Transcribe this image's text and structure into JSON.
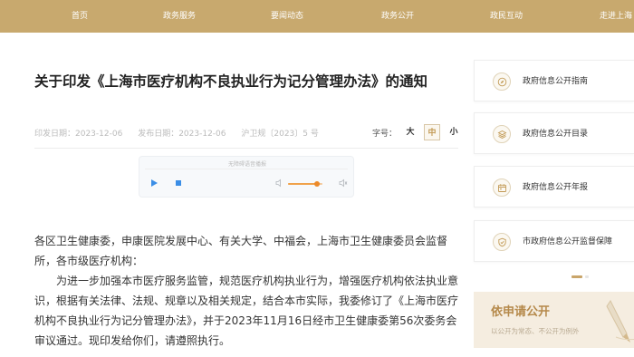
{
  "nav": {
    "items": [
      "首页",
      "政务服务",
      "要闻动态",
      "政务公开",
      "政民互动",
      "走进上海"
    ]
  },
  "article": {
    "title": "关于印发《上海市医疗机构不良执业行为记分管理办法》的通知",
    "print_date": "印发日期：2023-12-06",
    "publish_date": "发布日期：2023-12-06",
    "doc_no": "沪卫规〔2023〕5 号",
    "font_label": "字号：",
    "font_sizes": [
      "大",
      "中",
      "小"
    ],
    "font_active": "中",
    "recipients": "各区卫生健康委，申康医院发展中心、有关大学、中福会，上海市卫生健康委员会监督所，各市级医疗机构：",
    "paragraph": "为进一步加强本市医疗服务监管，规范医疗机构执业行为，增强医疗机构依法执业意识，根据有关法律、法规、规章以及相关规定，结合本市实际，我委修订了《上海市医疗机构不良执业行为记分管理办法》，并于2023年11月16日经市卫生健康委第56次委务会审议通过。现印发给你们，请遵照执行。"
  },
  "player": {
    "title": "无障碍语音播报",
    "volume": 0.85
  },
  "sidebar": {
    "items": [
      {
        "label": "政府信息公开指南",
        "icon": "compass-icon"
      },
      {
        "label": "政府信息公开目录",
        "icon": "layers-icon"
      },
      {
        "label": "政府信息公开年报",
        "icon": "calendar-icon"
      },
      {
        "label": "市政府信息公开监督保障",
        "icon": "shield-icon"
      }
    ],
    "apply": {
      "title": "依申请公开",
      "subtitle": "以公开为常态、不公开为例外"
    }
  },
  "colors": {
    "nav_bg": "#c8a96e",
    "accent": "#b5894a",
    "player_blue": "#3b8ee6",
    "volume_orange": "#ec8a2a"
  }
}
